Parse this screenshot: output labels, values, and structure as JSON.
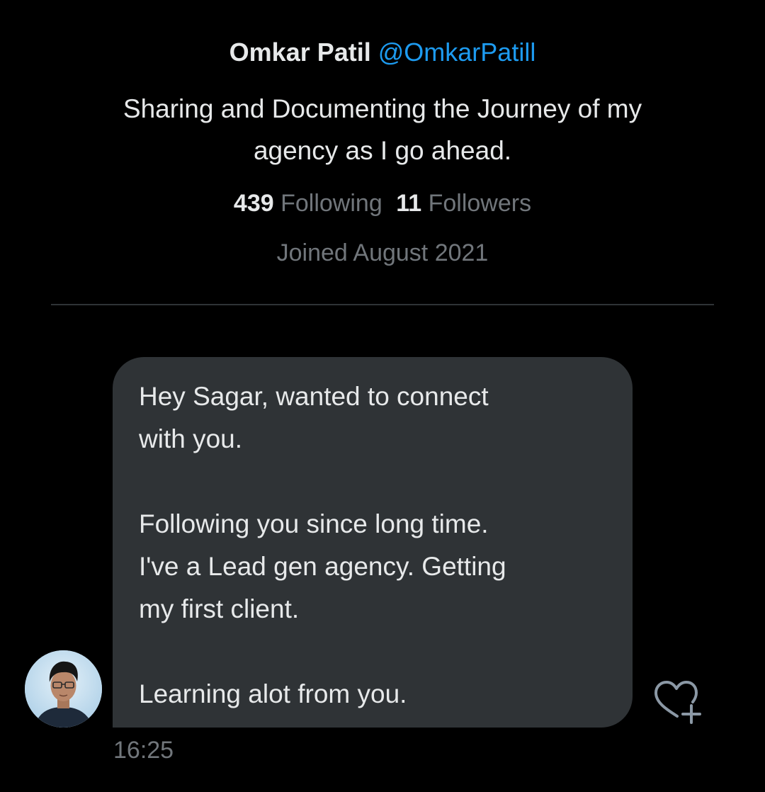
{
  "profile": {
    "display_name": "Omkar Patil",
    "handle": "@OmkarPatill",
    "bio_line1": "Sharing and Documenting the Journey of my",
    "bio_line2": "agency as I go ahead.",
    "following_count": "439",
    "following_label": "Following",
    "followers_count": "11",
    "followers_label": "Followers",
    "joined": "Joined August 2021"
  },
  "message": {
    "lines": [
      "Hey Sagar, wanted to connect",
      "with you.",
      "Following you since long time.",
      "I've a Lead gen agency. Getting",
      "my first client.",
      "Learning alot from you."
    ],
    "timestamp": "16:25"
  },
  "icons": {
    "avatar": "profile-photo",
    "reaction": "heart-plus-icon"
  },
  "colors": {
    "background": "#000000",
    "bubble": "#2f3336",
    "accent": "#1d9bf0",
    "muted_text": "#71767b",
    "primary_text": "#e7e9ea"
  }
}
